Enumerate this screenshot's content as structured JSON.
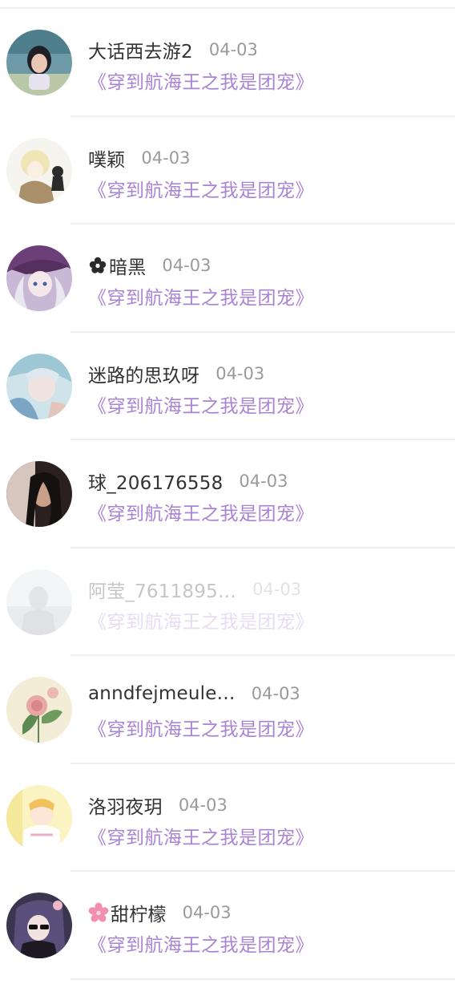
{
  "comments": [
    {
      "name": "大话西去游2",
      "date": "04-03",
      "book": "《穿到航海王之我是团宠》",
      "avatar": "avatar-girl-photo"
    },
    {
      "name": "噗颖",
      "date": "04-03",
      "book": "《穿到航海王之我是团宠》",
      "avatar": "avatar-anime-blonde"
    },
    {
      "name": "暗黑",
      "name_prefix_icon": "flower-icon",
      "date": "04-03",
      "book": "《穿到航海王之我是团宠》",
      "avatar": "avatar-anime-witch"
    },
    {
      "name": "迷路的思玖呀",
      "date": "04-03",
      "book": "《穿到航海王之我是团宠》",
      "avatar": "avatar-anime-silver-hair"
    },
    {
      "name": "球_206176558",
      "date": "04-03",
      "book": "《穿到航海王之我是团宠》",
      "avatar": "avatar-dark-portrait"
    },
    {
      "name": "阿莹_7611895…",
      "date": "04-03",
      "book": "《穿到航海王之我是团宠》",
      "avatar": "avatar-pale-photo",
      "faded": true
    },
    {
      "name": "anndfejmeule…",
      "date": "04-03",
      "book": "《穿到航海王之我是团宠》",
      "avatar": "avatar-flower-painting"
    },
    {
      "name": "洛羽夜玥",
      "date": "04-03",
      "book": "《穿到航海王之我是团宠》",
      "avatar": "avatar-anime-yellow"
    },
    {
      "name": "甜柠檬",
      "name_prefix_icon": "cherry-blossom-icon",
      "date": "04-03",
      "book": "《穿到航海王之我是团宠》",
      "avatar": "avatar-anime-sunglasses"
    }
  ],
  "colors": {
    "book_title": "#a983d6",
    "name": "#333333",
    "date": "#9a9a9a",
    "divider": "#f0f0f0"
  }
}
